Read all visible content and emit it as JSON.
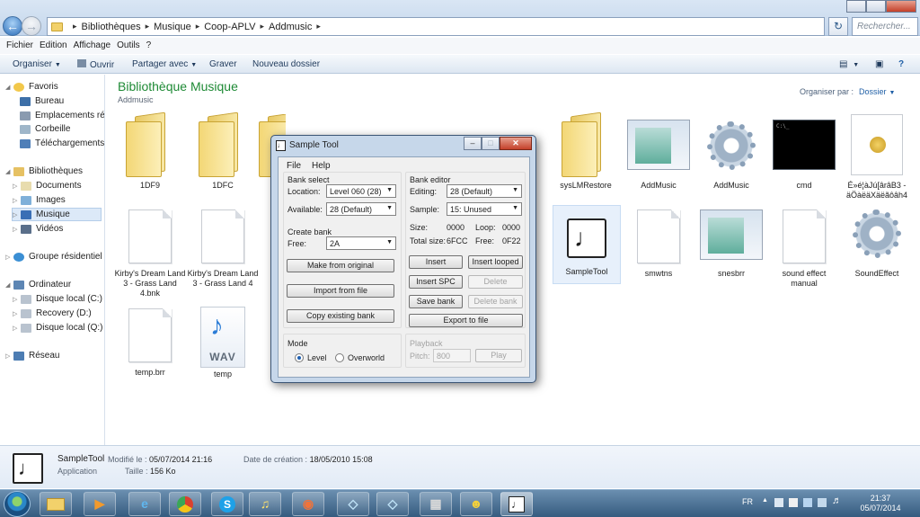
{
  "explorer": {
    "breadcrumb": [
      "Bibliothèques",
      "Musique",
      "Coop-APLV",
      "Addmusic"
    ],
    "search_placeholder": "Rechercher...",
    "menu": [
      "Fichier",
      "Edition",
      "Affichage",
      "Outils",
      "?"
    ],
    "commands": {
      "organize": "Organiser",
      "open": "Ouvrir",
      "share": "Partager avec",
      "burn": "Graver",
      "new_folder": "Nouveau dossier"
    },
    "nav": {
      "favorites": "Favoris",
      "desktop": "Bureau",
      "recent": "Emplacements réce",
      "recycle": "Corbeille",
      "downloads": "Téléchargements",
      "libraries": "Bibliothèques",
      "documents": "Documents",
      "images": "Images",
      "music": "Musique",
      "videos": "Vidéos",
      "homegroup": "Groupe résidentiel",
      "computer": "Ordinateur",
      "drive_c": "Disque local (C:)",
      "drive_d": "Recovery (D:)",
      "drive_q": "Disque local (Q:)",
      "network": "Réseau"
    },
    "library_title": "Bibliothèque Musique",
    "library_subtitle": "Addmusic",
    "arrange_label": "Organiser par :",
    "arrange_value": "Dossier",
    "files": {
      "f1": "1DF9",
      "f2": "1DFC",
      "f3": "sysLMRestore",
      "f4": "AddMusic",
      "f5": "AddMusic",
      "f6": "cmd",
      "f7": "É»é¦àJú[ârâB3 - äÖàëäXäëãôâh4",
      "f8": "Kirby's Dream Land 3 - Grass Land 4.bnk",
      "f9": "Kirby's Dream Land 3 - Grass Land 4",
      "f10": "SampleTool",
      "f11": "smwtns",
      "f12": "snesbrr",
      "f13": "sound effect manual",
      "f14": "SoundEffect",
      "f15": "temp.brr",
      "f16": "temp",
      "wav_badge": "WAV"
    },
    "details": {
      "name": "SampleTool",
      "type": "Application",
      "modified_label": "Modifié le :",
      "modified": "05/07/2014 21:16",
      "size_label": "Taille :",
      "size": "156 Ko",
      "created_label": "Date de création :",
      "created": "18/05/2010 15:08"
    }
  },
  "dialog": {
    "title": "Sample Tool",
    "menu": [
      "File",
      "Help"
    ],
    "bank_select": {
      "label": "Bank select",
      "location_label": "Location:",
      "location_value": "Level 060 (28)",
      "available_label": "Available:",
      "available_value": "28 (Default)"
    },
    "create_bank": {
      "label": "Create bank",
      "free_label": "Free:",
      "free_value": "2A",
      "make_original": "Make from original",
      "import_file": "Import from file",
      "copy_existing": "Copy existing bank"
    },
    "mode": {
      "label": "Mode",
      "level": "Level",
      "overworld": "Overworld",
      "selected": "Level"
    },
    "bank_editor": {
      "label": "Bank editor",
      "editing_label": "Editing:",
      "editing_value": "28 (Default)",
      "sample_label": "Sample:",
      "sample_value": "15: Unused",
      "size_label": "Size:",
      "size_value": "0000",
      "loop_label": "Loop:",
      "loop_value": "0000",
      "total_label": "Total size:",
      "total_value": "6FCC",
      "free_label": "Free:",
      "free_value": "0F22",
      "insert": "Insert",
      "insert_looped": "Insert looped",
      "insert_spc": "Insert SPC",
      "delete": "Delete",
      "save_bank": "Save bank",
      "delete_bank": "Delete bank",
      "export": "Export to file"
    },
    "playback": {
      "label": "Playback",
      "pitch_label": "Pitch:",
      "pitch_value": "800",
      "play": "Play"
    }
  },
  "taskbar": {
    "language": "FR",
    "time": "21:37",
    "date": "05/07/2014"
  }
}
